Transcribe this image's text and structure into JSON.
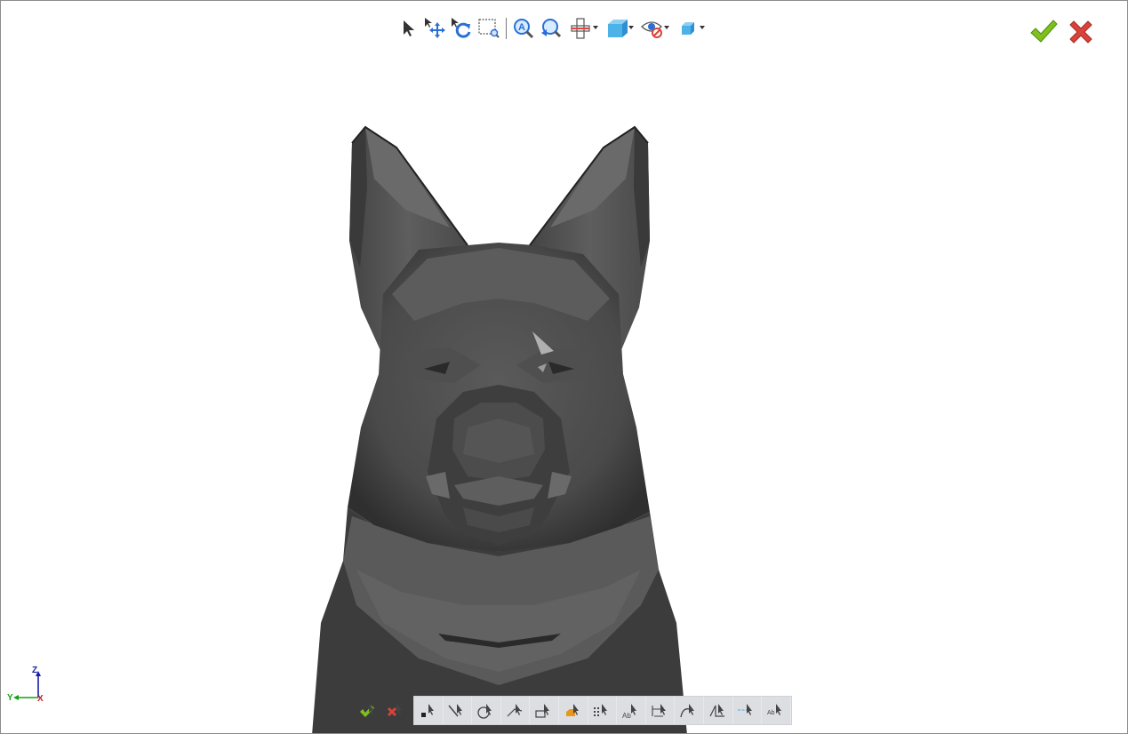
{
  "viewport": {
    "background": "#ffffff",
    "model": "dog-head-mesh",
    "model_color": "#4b4b4b"
  },
  "view_toolbar": {
    "tools": [
      "select-arrow-icon",
      "pan-icon",
      "rotate-icon",
      "zoom-window-icon",
      "zoom-all-icon",
      "zoom-previous-icon",
      "section-view-icon",
      "view-orientation-icon",
      "hide-show-icon",
      "display-style-icon"
    ]
  },
  "dialog_buttons": {
    "ok_icon": "green-check-icon",
    "cancel_icon": "red-x-icon",
    "ok_color": "#7fbf1e",
    "cancel_color": "#d9433a"
  },
  "triad": {
    "z_label": "Z",
    "y_label": "Y",
    "x_label": "X",
    "z_color": "#1a1aa8",
    "y_color": "#12a012",
    "x_color": "#c02020"
  },
  "selection_toolbar": {
    "accept_icon": "accept-selection-icon",
    "cancel_icon": "cancel-selection-icon",
    "filters": [
      "select-vertex-icon",
      "select-edge-icon",
      "select-face-icon",
      "select-surface-icon",
      "select-body-icon",
      "select-part-icon",
      "select-points-icon",
      "select-annotation-icon",
      "select-dimension-icon",
      "select-curve-icon",
      "select-plane-icon",
      "select-axis-icon",
      "select-sketch-text-icon"
    ]
  }
}
